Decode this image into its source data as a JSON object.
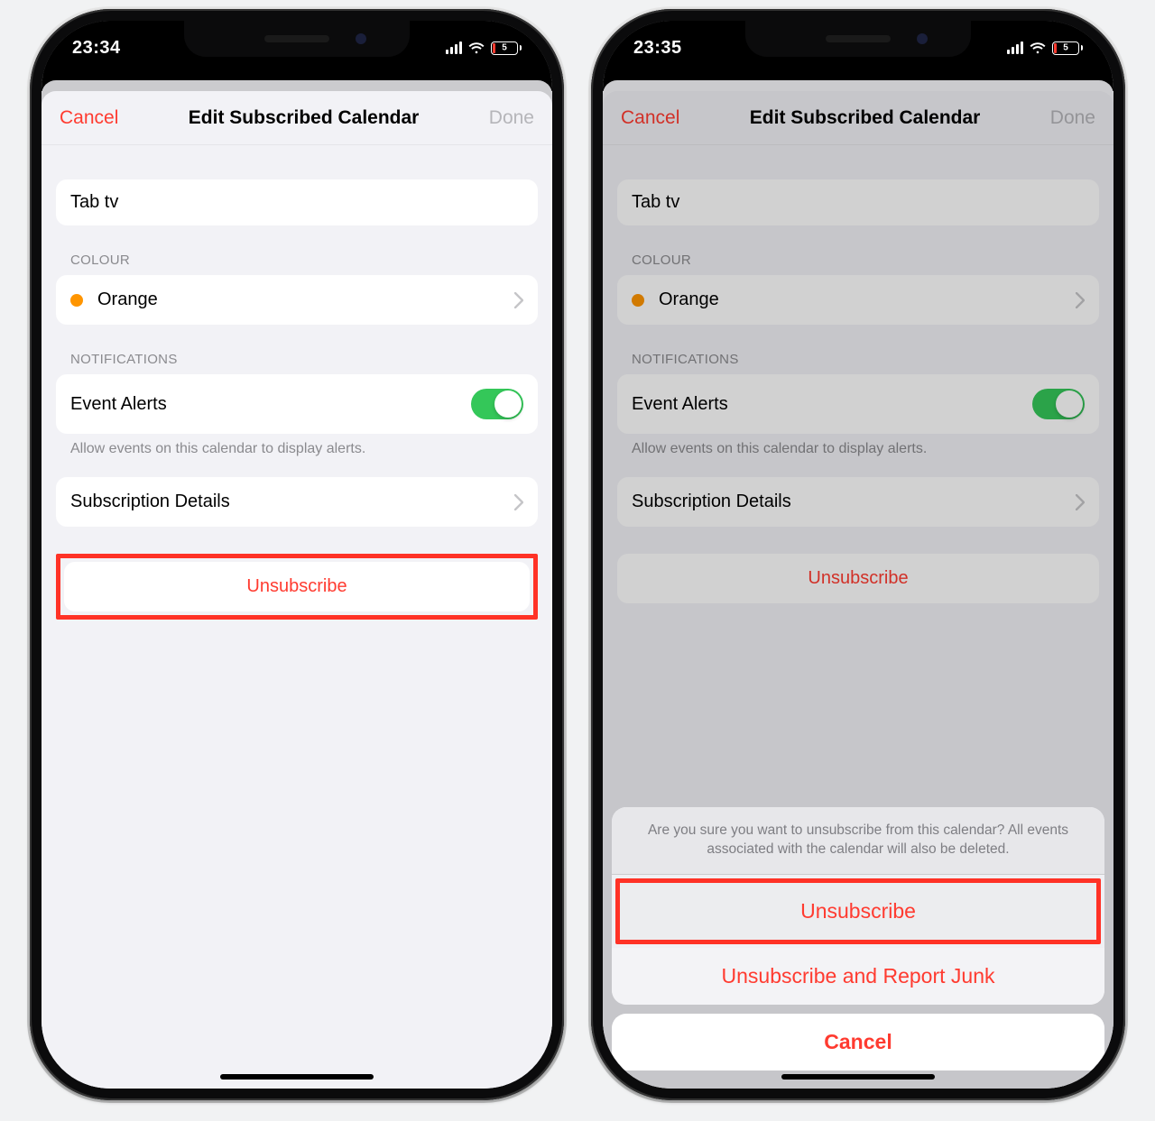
{
  "left": {
    "status_time": "23:34",
    "battery_pct": "5",
    "nav": {
      "cancel": "Cancel",
      "title": "Edit Subscribed Calendar",
      "done": "Done"
    },
    "calendar_name": "Tab tv",
    "sections": {
      "colour": {
        "header": "COLOUR",
        "value": "Orange",
        "colour_hex": "#ff9500"
      },
      "notifications": {
        "header": "NOTIFICATIONS",
        "event_alerts_label": "Event Alerts",
        "event_alerts_on": true,
        "hint": "Allow events on this calendar to display alerts."
      },
      "subscription_details": "Subscription Details",
      "unsubscribe": "Unsubscribe"
    }
  },
  "right": {
    "status_time": "23:35",
    "battery_pct": "5",
    "nav": {
      "cancel": "Cancel",
      "title": "Edit Subscribed Calendar",
      "done": "Done"
    },
    "calendar_name": "Tab tv",
    "sections": {
      "colour": {
        "header": "COLOUR",
        "value": "Orange",
        "colour_hex": "#ff9500"
      },
      "notifications": {
        "header": "NOTIFICATIONS",
        "event_alerts_label": "Event Alerts",
        "event_alerts_on": true,
        "hint": "Allow events on this calendar to display alerts."
      },
      "subscription_details": "Subscription Details",
      "unsubscribe": "Unsubscribe"
    },
    "action_sheet": {
      "message": "Are you sure you want to unsubscribe from this calendar? All events associated with the calendar will also be deleted.",
      "unsubscribe": "Unsubscribe",
      "unsubscribe_report": "Unsubscribe and Report Junk",
      "cancel": "Cancel"
    }
  }
}
